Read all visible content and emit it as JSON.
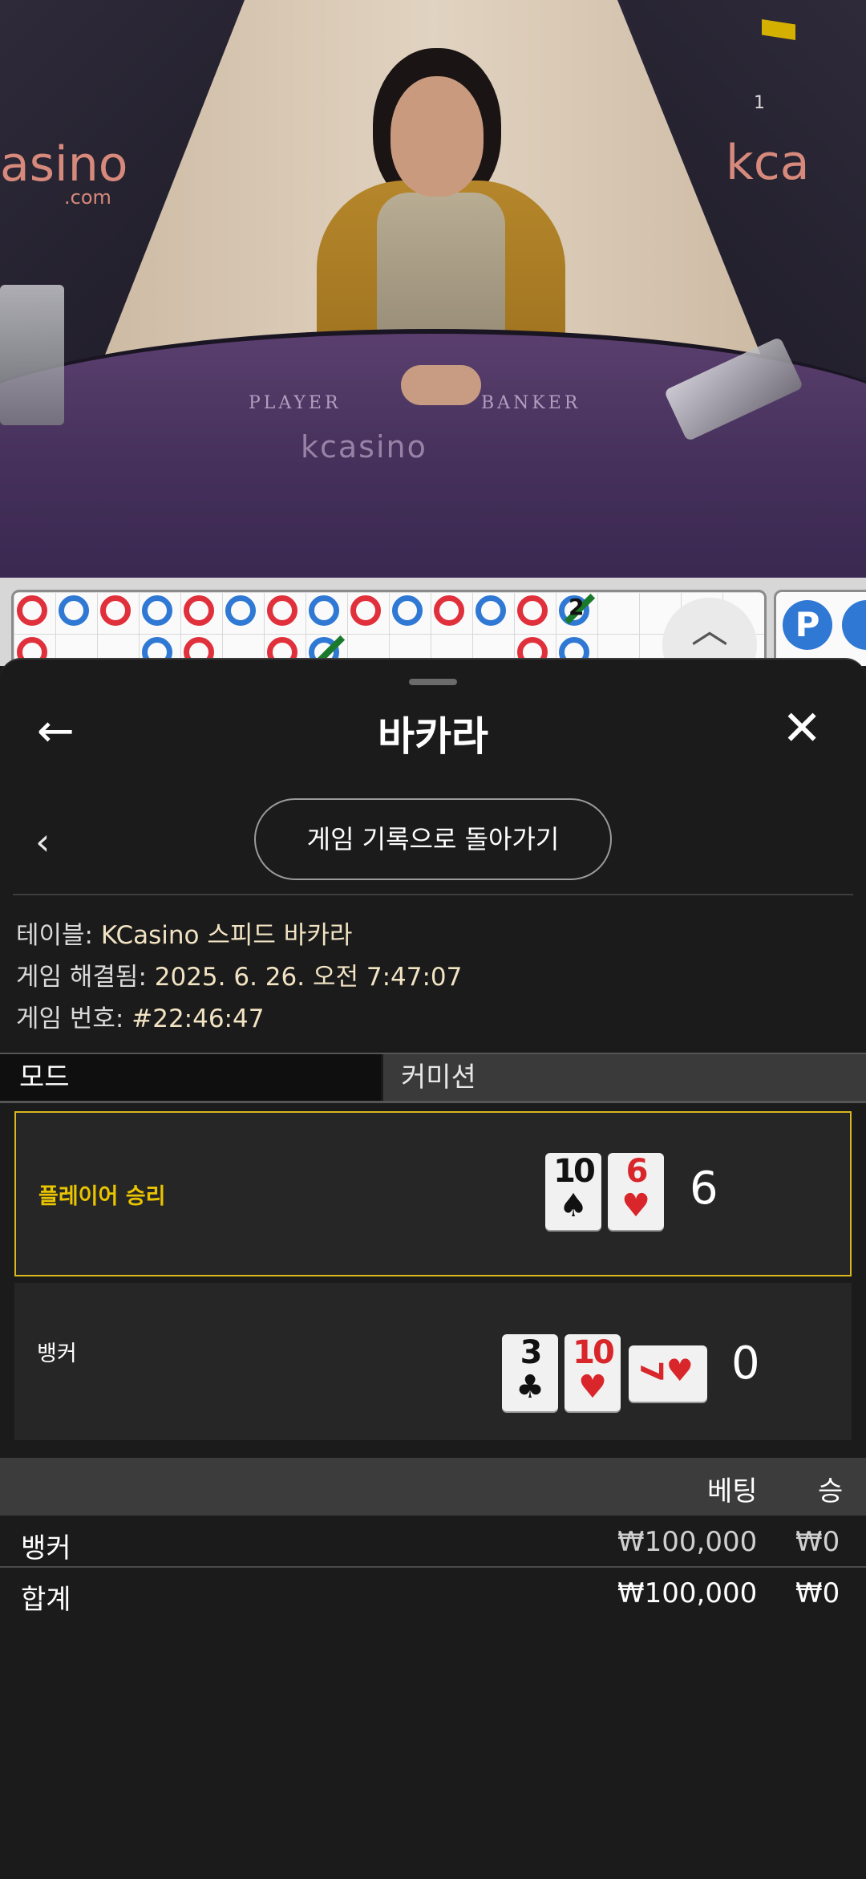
{
  "video": {
    "round_number": "1",
    "table_print_player": "PLAYER",
    "table_print_banker": "BANKER",
    "brand_logo": "kcasino",
    "brand_logo_sub": ".com",
    "brand_logo_left": "asino",
    "brand_logo_right": "kca"
  },
  "roadmap": {
    "tie_count": "2",
    "badge": "P"
  },
  "header": {
    "title": "바카라",
    "back_icon": "←",
    "close_icon": "✕"
  },
  "history": {
    "back_chevron": "‹",
    "button_label": "게임 기록으로 돌아가기"
  },
  "info": {
    "table_label": "테이블:",
    "table_value": "KCasino 스피드 바카라",
    "resolved_label": "게임 해결됨:",
    "resolved_value": "2025. 6. 26. 오전 7:47:07",
    "game_no_label": "게임 번호:",
    "game_no_value": "#22:46:47"
  },
  "tabs": {
    "mode": "모드",
    "commission": "커미션"
  },
  "result": {
    "player": {
      "label": "플레이어 승리",
      "score": "6",
      "cards": [
        {
          "rank": "10",
          "suit": "♠",
          "color": "black"
        },
        {
          "rank": "6",
          "suit": "♥",
          "color": "red"
        }
      ]
    },
    "banker": {
      "label": "뱅커",
      "score": "0",
      "cards": [
        {
          "rank": "3",
          "suit": "♣",
          "color": "black"
        },
        {
          "rank": "10",
          "suit": "♥",
          "color": "red"
        },
        {
          "rank": "7",
          "suit": "♥",
          "color": "red"
        }
      ]
    }
  },
  "bets": {
    "col_bet": "베팅",
    "col_win": "승",
    "rows": [
      {
        "name": "뱅커",
        "bet": "₩100,000",
        "win": "₩0"
      }
    ],
    "total": {
      "name": "합계",
      "bet": "₩100,000",
      "win": "₩0"
    }
  },
  "colors": {
    "win_border": "#d8b820",
    "win_label": "#e9c400",
    "banker_red": "#e0303c",
    "player_blue": "#2f78d4"
  }
}
